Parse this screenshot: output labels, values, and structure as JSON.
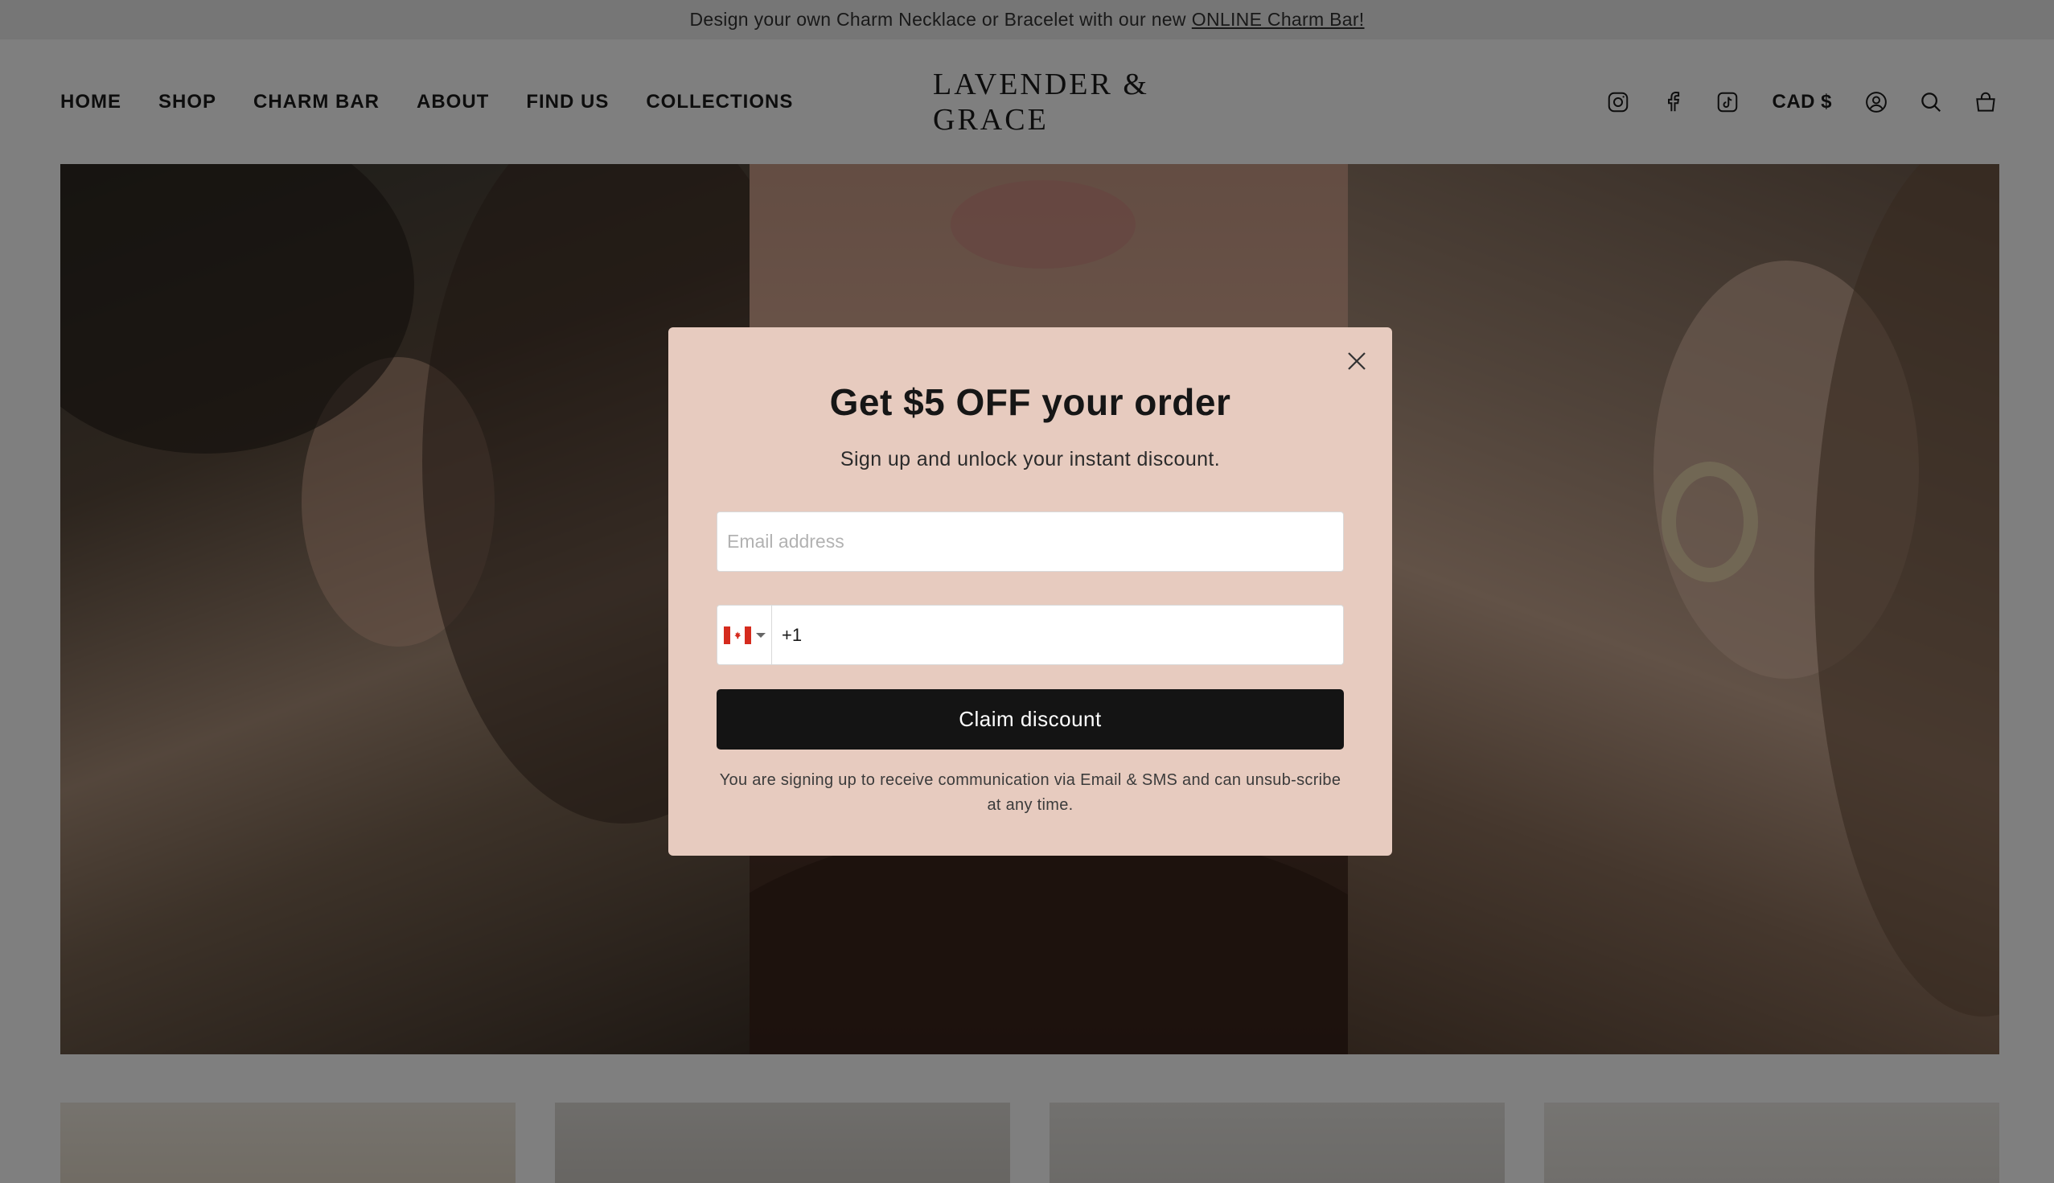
{
  "announcement": {
    "text": "Design your own Charm Necklace or Bracelet with our new",
    "link_text": "ONLINE Charm Bar!"
  },
  "nav": {
    "items": [
      {
        "label": "HOME"
      },
      {
        "label": "SHOP"
      },
      {
        "label": "CHARM BAR"
      },
      {
        "label": "ABOUT"
      },
      {
        "label": "FIND US"
      },
      {
        "label": "COLLECTIONS"
      }
    ]
  },
  "header": {
    "logo": "LAVENDER & GRACE",
    "currency": "CAD $",
    "icons": [
      "instagram-icon",
      "facebook-icon",
      "tiktok-icon",
      "account-icon",
      "search-icon",
      "cart-icon"
    ]
  },
  "modal": {
    "title": "Get $5 OFF your order",
    "subtitle": "Sign up and unlock your instant discount.",
    "email_placeholder": "Email address",
    "phone_country_code": "+1",
    "submit_label": "Claim discount",
    "disclaimer": "You are signing up to receive communication via Email & SMS and can unsub-scribe at any time."
  },
  "colors": {
    "modal_bg": "#e7cbbf",
    "button_bg": "#141414",
    "overlay": "rgba(0,0,0,0.5)"
  }
}
